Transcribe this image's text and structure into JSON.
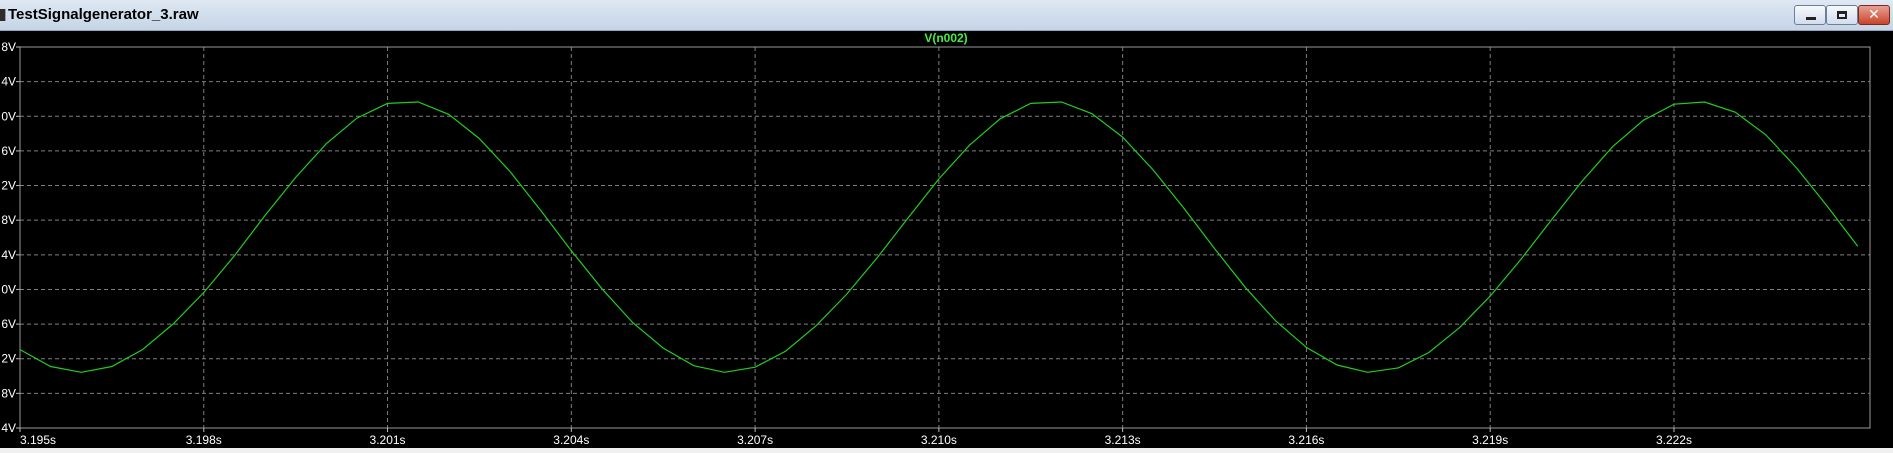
{
  "window": {
    "title": "TestSignalgenerator_3.raw",
    "minimize_glyph": "minimize-icon",
    "maximize_glyph": "maximize-icon",
    "close_glyph": "✕"
  },
  "colors": {
    "background": "#000000",
    "grid": "#7f7f7f",
    "trace": "#22cc22",
    "axis_text": "#ffffff",
    "trace_title": "#44ee44"
  },
  "chart_data": {
    "type": "line",
    "title": "V(n002)",
    "xlabel": "",
    "ylabel": "",
    "grid": true,
    "xlim": [
      3.195,
      3.2252
    ],
    "ylim": [
      -4.4,
      0.8
    ],
    "x_ticks": [
      "3.195s",
      "3.198s",
      "3.201s",
      "3.204s",
      "3.207s",
      "3.210s",
      "3.213s",
      "3.216s",
      "3.219s",
      "3.222s"
    ],
    "y_ticks": [
      "8V",
      "4V",
      "0V",
      "6V",
      "2V",
      "8V",
      "4V",
      "0V",
      "6V",
      "2V",
      "8V",
      "4V"
    ],
    "series": [
      {
        "name": "V(n002)",
        "x": [
          3.195,
          3.1955,
          3.196,
          3.1965,
          3.197,
          3.1975,
          3.198,
          3.1985,
          3.199,
          3.1995,
          3.2,
          3.2005,
          3.201,
          3.2015,
          3.202,
          3.2025,
          3.203,
          3.2035,
          3.204,
          3.2045,
          3.205,
          3.2055,
          3.206,
          3.2065,
          3.207,
          3.2075,
          3.208,
          3.2085,
          3.209,
          3.2095,
          3.21,
          3.2105,
          3.211,
          3.2115,
          3.212,
          3.2125,
          3.213,
          3.2135,
          3.214,
          3.2145,
          3.215,
          3.2155,
          3.216,
          3.2165,
          3.217,
          3.2175,
          3.218,
          3.2185,
          3.219,
          3.2195,
          3.22,
          3.2205,
          3.221,
          3.2215,
          3.222,
          3.2225,
          3.223,
          3.2235,
          3.224,
          3.2245,
          3.225
        ],
        "y": [
          -3.33,
          -3.56,
          -3.64,
          -3.56,
          -3.33,
          -2.98,
          -2.55,
          -2.05,
          -1.5,
          -0.98,
          -0.52,
          -0.17,
          0.03,
          0.05,
          -0.12,
          -0.45,
          -0.9,
          -1.43,
          -1.98,
          -2.5,
          -2.96,
          -3.31,
          -3.55,
          -3.64,
          -3.57,
          -3.35,
          -3.0,
          -2.57,
          -2.07,
          -1.53,
          -1.0,
          -0.54,
          -0.18,
          0.03,
          0.05,
          -0.11,
          -0.43,
          -0.88,
          -1.4,
          -1.95,
          -2.48,
          -2.94,
          -3.3,
          -3.54,
          -3.64,
          -3.58,
          -3.37,
          -3.03,
          -2.6,
          -2.1,
          -1.56,
          -1.03,
          -0.56,
          -0.2,
          0.02,
          0.05,
          -0.09,
          -0.4,
          -0.85,
          -1.37,
          -1.92
        ]
      }
    ]
  }
}
